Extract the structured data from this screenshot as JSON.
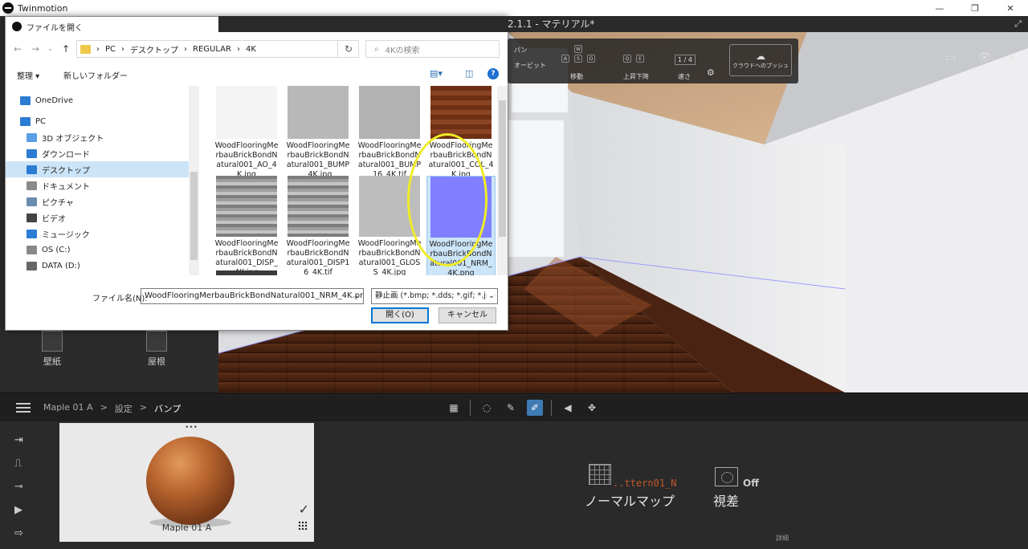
{
  "app": {
    "title": "Twinmotion",
    "window_controls": [
      "—",
      "❐",
      "✕"
    ]
  },
  "viewport": {
    "title": "2.1.1 - マテリアル*",
    "nav": {
      "pan": "パン",
      "orbit": "オービット",
      "move": "移動",
      "updown": "上昇下降",
      "speed": "速さ",
      "speed_value": "1 / 4",
      "cloud_push": "クラウドへのプッシュ"
    }
  },
  "left_panel": {
    "items": [
      {
        "label": "壁紙"
      },
      {
        "label": "屋根"
      }
    ]
  },
  "bottom_bar": {
    "breadcrumb": [
      "Maple 01 A",
      "設定",
      "バンプ"
    ]
  },
  "bottom_panel": {
    "material_name": "Maple 01 A",
    "normal_map_file": "..ttern01_N",
    "normal_map_label": "ノーマルマップ",
    "parallax_value": "Off",
    "parallax_label": "視差",
    "detail_label": "詳細"
  },
  "dialog": {
    "title": "ファイルを開く",
    "path": [
      "PC",
      "デスクトップ",
      "REGULAR",
      "4K"
    ],
    "search_placeholder": "4Kの検索",
    "organize": "整理 ▾",
    "new_folder": "新しいフォルダー",
    "nav_items": [
      {
        "label": "OneDrive",
        "color": "#2b7cd3"
      },
      {
        "label": "PC",
        "color": "#2b7cd3"
      },
      {
        "label": "3D オブジェクト",
        "color": "#5aa0e6"
      },
      {
        "label": "ダウンロード",
        "color": "#2b7cd3"
      },
      {
        "label": "デスクトップ",
        "color": "#2b7cd3"
      },
      {
        "label": "ドキュメント",
        "color": "#8a8a8a"
      },
      {
        "label": "ピクチャ",
        "color": "#6a8caf"
      },
      {
        "label": "ビデオ",
        "color": "#444444"
      },
      {
        "label": "ミュージック",
        "color": "#2b7cd3"
      },
      {
        "label": "OS (C:)",
        "color": "#888888"
      },
      {
        "label": "DATA (D:)",
        "color": "#666666"
      }
    ],
    "files": [
      {
        "name": "WoodFlooringMerbauBrickBondNatural001_AO_4K.jpg",
        "thumb": "#f4f4f4"
      },
      {
        "name": "WoodFlooringMerbauBrickBondNatural001_BUMP_4K.jpg",
        "thumb": "#b8b8b8"
      },
      {
        "name": "WoodFlooringMerbauBrickBondNatural001_BUMP16_4K.tif",
        "thumb": "#b2b2b2"
      },
      {
        "name": "WoodFlooringMerbauBrickBondNatural001_COL_4K.jpg",
        "thumb": "#7a3517"
      },
      {
        "name": "WoodFlooringMerbauBrickBondNatural001_DISP_4K.jpg",
        "thumb": "#9a9a9a"
      },
      {
        "name": "WoodFlooringMerbauBrickBondNatural001_DISP16_4K.tif",
        "thumb": "#a4a4a4"
      },
      {
        "name": "WoodFlooringMerbauBrickBondNatural001_GLOSS_4K.jpg",
        "thumb": "#bdbdbd"
      },
      {
        "name": "WoodFlooringMerbauBrickBondNatural001_NRM_4K.png",
        "thumb": "#7f7fff"
      }
    ],
    "filename_label": "ファイル名(N):",
    "filename_value": "WoodFlooringMerbauBrickBondNatural001_NRM_4K.png",
    "filetype_value": "静止画 (*.bmp; *.dds; *.gif; *.jpe",
    "open_button": "開く(O)",
    "cancel_button": "キャンセル"
  }
}
